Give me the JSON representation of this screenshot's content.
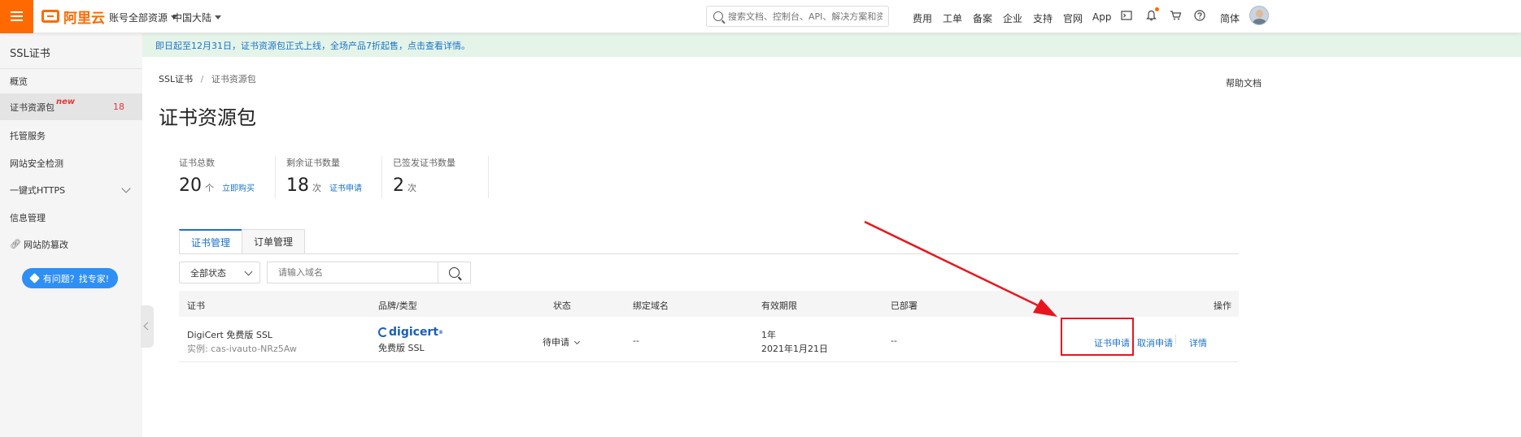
{
  "topbar": {
    "logo_text": "阿里云",
    "account_dropdown": "账号全部资源",
    "region_dropdown": "中国大陆",
    "search_placeholder": "搜索文档、控制台、API、解决方案和资源",
    "links": [
      "费用",
      "工单",
      "备案",
      "企业",
      "支持",
      "官网",
      "App"
    ],
    "lang": "简体",
    "accent_color": "#ff6a00"
  },
  "sidebar": {
    "title": "SSL证书",
    "items": [
      {
        "label": "概览"
      },
      {
        "label": "证书资源包",
        "tag": "new",
        "count": "18"
      },
      {
        "label": "托管服务"
      },
      {
        "label": "网站安全检测"
      },
      {
        "label": "一键式HTTPS"
      },
      {
        "label": "信息管理"
      },
      {
        "label": "网站防篡改"
      }
    ],
    "help_button": "有问题？找专家!"
  },
  "banner": {
    "text": "即日起至12月31日，证书资源包正式上线，全场产品7折起售，点击查看详情。"
  },
  "breadcrumb": {
    "root": "SSL证书",
    "sep": "/",
    "current": "证书资源包"
  },
  "help_doc": "帮助文档",
  "page_title": "证书资源包",
  "stats": [
    {
      "label": "证书总数",
      "value": "20",
      "unit": "个",
      "action": "立即购买"
    },
    {
      "label": "剩余证书数量",
      "value": "18",
      "unit": "次",
      "action": "证书申请"
    },
    {
      "label": "已签发证书数量",
      "value": "2",
      "unit": "次",
      "action": ""
    }
  ],
  "tabs": [
    "证书管理",
    "订单管理"
  ],
  "filter": {
    "status_value": "全部状态",
    "domain_placeholder": "请输入域名"
  },
  "table": {
    "headers": [
      "证书",
      "品牌/类型",
      "状态",
      "绑定域名",
      "有效期限",
      "已部署",
      "操作"
    ],
    "rows": [
      {
        "cert_name": "DigiCert 免费版 SSL",
        "instance": "实例: cas-ivauto-NRz5Aw",
        "brand_logo": "digicert",
        "brand_type": "免费版 SSL",
        "status": "待申请",
        "domain": "--",
        "validity_term": "1年",
        "validity_date": "2021年1月21日",
        "deployed": "--",
        "actions": [
          "证书申请",
          "取消申请",
          "详情"
        ]
      }
    ]
  },
  "colors": {
    "link": "#1a73c7",
    "highlight": "#e8161c",
    "banner_bg": "#e5f4e9"
  }
}
